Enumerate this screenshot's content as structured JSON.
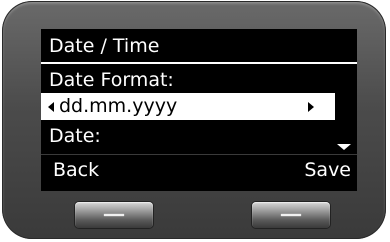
{
  "screen": {
    "title": "Date / Time",
    "field_label": "Date Format:",
    "selected_value": "dd.mm.yyyy",
    "next_field_label": "Date:"
  },
  "softkeys": {
    "left_label": "Back",
    "right_label": "Save"
  },
  "icons": {
    "left": "arrow-left-icon",
    "right": "arrow-right-icon",
    "scroll": "scroll-down-icon"
  },
  "colors": {
    "screen_bg": "#000000",
    "text": "#ffffff",
    "highlight_bg": "#ffffff",
    "highlight_text": "#000000",
    "bezel": "#4b4b4b"
  }
}
